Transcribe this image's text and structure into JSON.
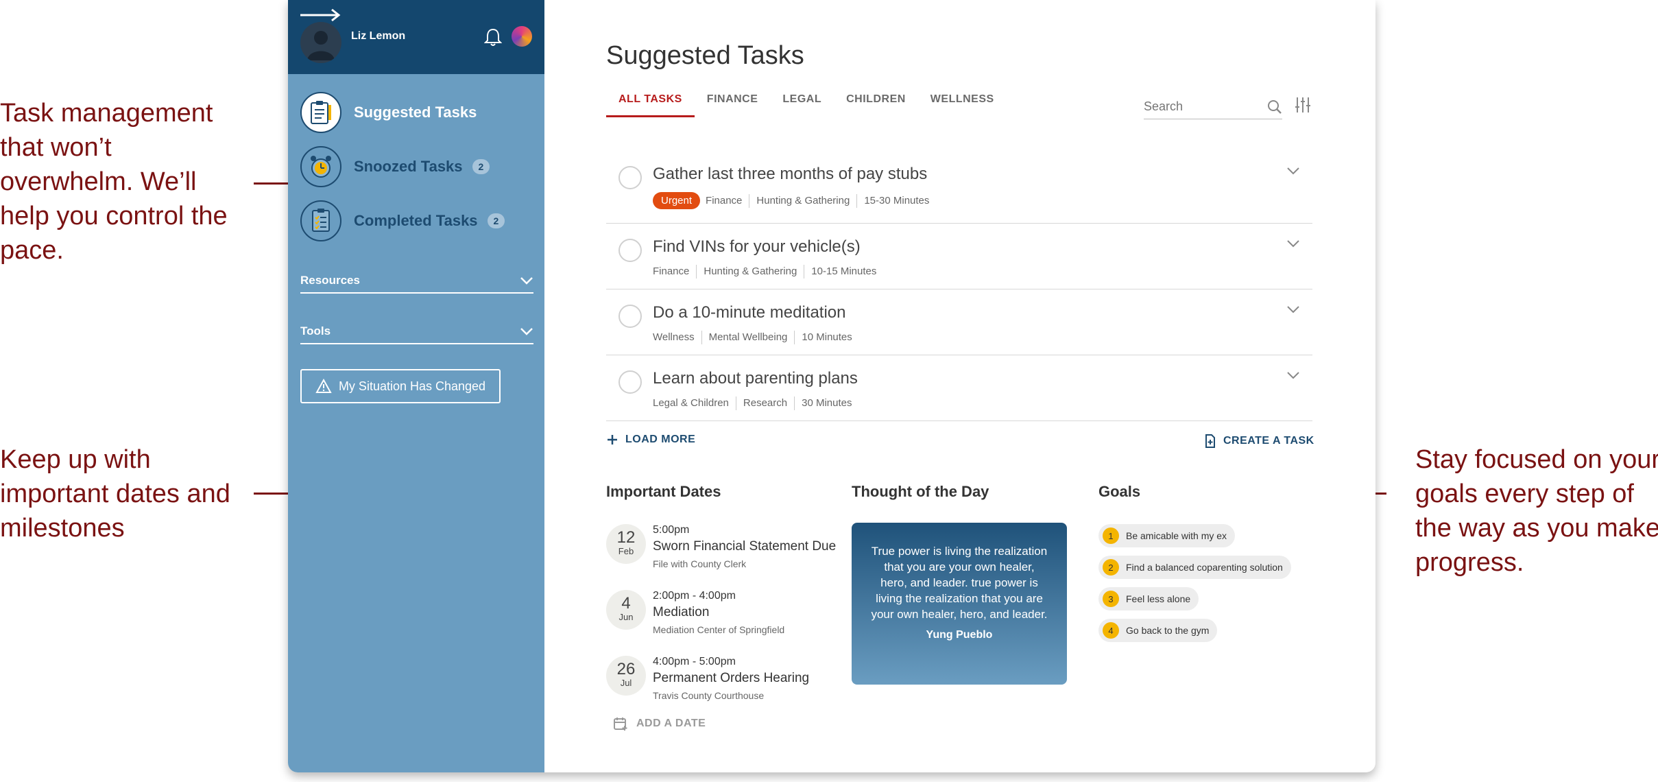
{
  "callouts": {
    "left_top": "Task management that won’t overwhelm. We’ll help you control the pace.",
    "left_bottom": "Keep up with important dates and milestones",
    "right": "Stay focused on your goals every step of the way as you make progress."
  },
  "user": {
    "name": "Liz Lemon"
  },
  "sidebar": {
    "nav": [
      {
        "label": "Suggested Tasks",
        "badge": ""
      },
      {
        "label": "Snoozed Tasks",
        "badge": "2"
      },
      {
        "label": "Completed Tasks",
        "badge": "2"
      }
    ],
    "sections": [
      {
        "label": "Resources"
      },
      {
        "label": "Tools"
      }
    ],
    "situation_button": "My Situation Has Changed"
  },
  "main": {
    "title": "Suggested Tasks",
    "tabs": [
      "ALL TASKS",
      "FINANCE",
      "LEGAL",
      "CHILDREN",
      "WELLNESS"
    ],
    "active_tab": "ALL TASKS",
    "search_placeholder": "Search",
    "tasks": [
      {
        "title": "Gather last three months of pay stubs",
        "urgent": "Urgent",
        "tags": [
          "Finance",
          "Hunting & Gathering",
          "15-30 Minutes"
        ]
      },
      {
        "title": "Find VINs for your vehicle(s)",
        "tags": [
          "Finance",
          "Hunting & Gathering",
          "10-15 Minutes"
        ]
      },
      {
        "title": "Do a 10-minute meditation",
        "tags": [
          "Wellness",
          "Mental Wellbeing",
          "10 Minutes"
        ]
      },
      {
        "title": "Learn about parenting plans",
        "tags": [
          "Legal & Children",
          "Research",
          "30 Minutes"
        ]
      }
    ],
    "load_more": "LOAD MORE",
    "create_task": "CREATE A TASK"
  },
  "important_dates": {
    "title": "Important Dates",
    "items": [
      {
        "day": "12",
        "month": "Feb",
        "time": "5:00pm",
        "title": "Sworn Financial Statement Due",
        "location": "File with County Clerk"
      },
      {
        "day": "4",
        "month": "Jun",
        "time": "2:00pm - 4:00pm",
        "title": "Mediation",
        "location": "Mediation Center of Springfield"
      },
      {
        "day": "26",
        "month": "Jul",
        "time": "4:00pm - 5:00pm",
        "title": "Permanent Orders Hearing",
        "location": "Travis County Courthouse"
      }
    ],
    "add_date": "ADD A DATE"
  },
  "thought": {
    "title": "Thought of the Day",
    "quote": "True power is living the realization that you are your own healer, hero, and leader. true power is living the realization that you are your own healer, hero, and leader.",
    "author": "Yung Pueblo"
  },
  "goals": {
    "title": "Goals",
    "items": [
      {
        "num": "1",
        "label": "Be amicable with my ex"
      },
      {
        "num": "2",
        "label": "Find a balanced coparenting solution"
      },
      {
        "num": "3",
        "label": "Feel less alone"
      },
      {
        "num": "4",
        "label": "Go back to the gym"
      }
    ]
  },
  "colors": {
    "sidebar": "#6a9dc1",
    "sidebar_header": "#14476e",
    "accent_red": "#b71c1c",
    "urgent": "#e24c10",
    "goal_badge": "#f4b400",
    "callout": "#7a1212"
  }
}
